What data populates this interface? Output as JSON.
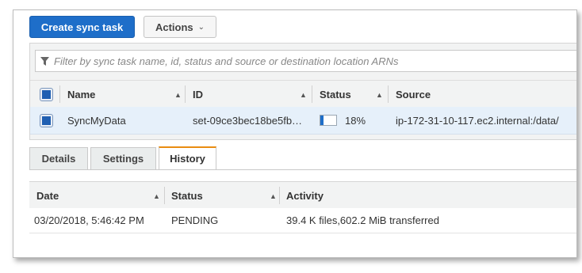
{
  "toolbar": {
    "create_label": "Create sync task",
    "actions_label": "Actions"
  },
  "filter": {
    "placeholder": "Filter by sync task name, id, status and source or destination location ARNs"
  },
  "tasks_table": {
    "columns": [
      "Name",
      "ID",
      "Status",
      "Source"
    ],
    "rows": [
      {
        "name": "SyncMyData",
        "id": "set-09ce3bec18be5fb…",
        "status_percent_label": "18%",
        "progress_fraction": 0.18,
        "source": "ip-172-31-10-117.ec2.internal:/data/"
      }
    ]
  },
  "tabs": [
    "Details",
    "Settings",
    "History"
  ],
  "active_tab": "History",
  "history_table": {
    "columns": [
      "Date",
      "Status",
      "Activity"
    ],
    "rows": [
      {
        "date": "03/20/2018, 5:46:42 PM",
        "status": "PENDING",
        "activity": "39.4 K files,602.2 MiB transferred"
      }
    ]
  },
  "colors": {
    "primary": "#1e6ec9",
    "active_tab_accent": "#e98c11",
    "selected_row": "#e6f0fa"
  }
}
